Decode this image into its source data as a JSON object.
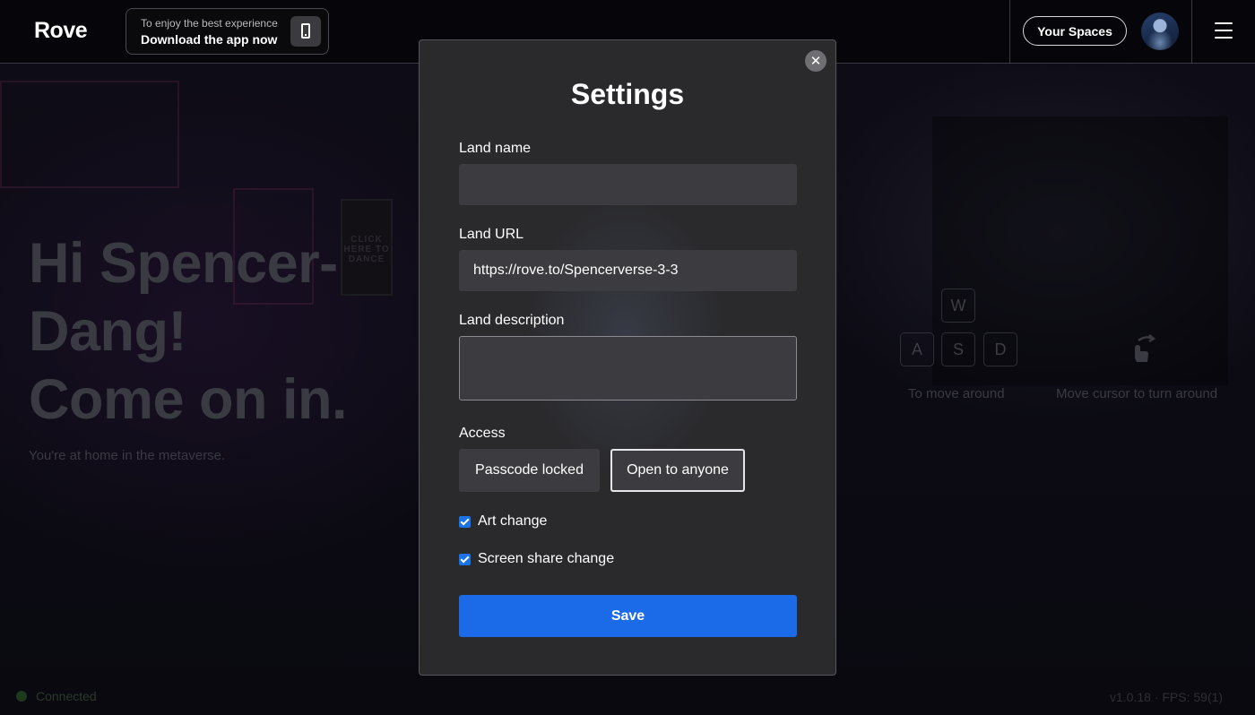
{
  "topbar": {
    "logo": "Rove",
    "promo_small": "To enjoy the best experience",
    "promo_big": "Download the app now",
    "spaces_label": "Your Spaces"
  },
  "background": {
    "hero_line1": "Hi Spencer-",
    "hero_line2": "Dang!",
    "hero_line3": "Come on in.",
    "hero_sub": "You're at home in the metaverse.",
    "poster_text": "CLICK HERE TO DANCE",
    "keys": [
      "W",
      "A",
      "S",
      "D"
    ],
    "move_hint": "To move around",
    "turn_hint": "Move cursor to turn around",
    "status": "Connected",
    "version": "v1.0.18  ·  FPS: 59(1)"
  },
  "modal": {
    "title": "Settings",
    "close_glyph": "✕",
    "land_name_label": "Land name",
    "land_name_value": "",
    "land_url_label": "Land URL",
    "land_url_value": "https://rove.to/Spencerverse-3-3",
    "land_description_label": "Land description",
    "land_description_value": "",
    "access_label": "Access",
    "access_options": [
      "Passcode locked",
      "Open to anyone"
    ],
    "access_selected": "Open to anyone",
    "art_change_label": "Art change",
    "art_change_checked": true,
    "screen_share_label": "Screen share change",
    "screen_share_checked": true,
    "save_label": "Save"
  },
  "colors": {
    "accent": "#1b6ae8",
    "modal_bg": "#2a2a2d",
    "input_bg": "#3c3c40"
  }
}
